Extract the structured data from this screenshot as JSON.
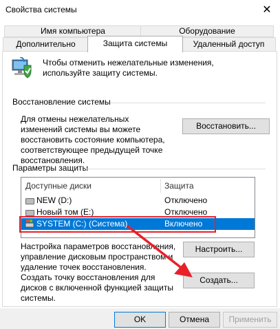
{
  "window": {
    "title": "Свойства системы",
    "close_label": "✕"
  },
  "tabs": {
    "back": [
      "Имя компьютера",
      "Оборудование"
    ],
    "front": [
      "Дополнительно",
      "Защита системы",
      "Удаленный доступ"
    ],
    "active": "Защита системы"
  },
  "intro": {
    "text": "Чтобы отменить нежелательные изменения, используйте защиту системы."
  },
  "restore": {
    "header": "Восстановление системы",
    "text": "Для отмены нежелательных изменений системы вы можете восстановить состояние компьютера, соответствующее предыдущей точке восстановления.",
    "button": "Восстановить..."
  },
  "protection": {
    "header": "Параметры защиты",
    "columns": [
      "Доступные диски",
      "Защита"
    ],
    "rows": [
      {
        "name": "NEW (D:)",
        "status": "Отключено"
      },
      {
        "name": "Новый том (E:)",
        "status": "Отключено"
      },
      {
        "name": "SYSTEM (C:) (Система)",
        "status": "Включено"
      }
    ]
  },
  "configure": {
    "text": "Настройка параметров восстановления, управление дисковым пространством и удаление точек восстановления.",
    "button": "Настроить..."
  },
  "create": {
    "text": "Создать точку восстановления для дисков с включенной функцией защиты системы.",
    "button": "Создать..."
  },
  "footer": {
    "ok": "OK",
    "cancel": "Отмена",
    "apply": "Применить"
  },
  "colors": {
    "selection": "#0078d7",
    "highlight": "#e8202a"
  }
}
